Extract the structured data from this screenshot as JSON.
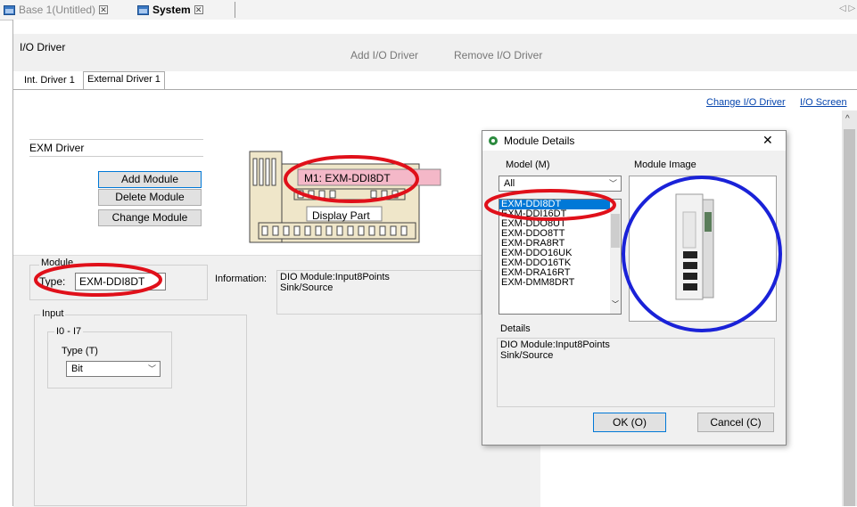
{
  "tabs": [
    {
      "label": "Base 1(Untitled)",
      "active": false
    },
    {
      "label": "System",
      "active": true
    }
  ],
  "header": {
    "title": "I/O Driver",
    "add_label": "Add I/O Driver",
    "remove_label": "Remove I/O Driver"
  },
  "driver_tabs": [
    "Int. Driver 1",
    "External Driver 1"
  ],
  "links": {
    "change_driver": "Change I/O Driver",
    "io_screen": "I/O Screen"
  },
  "driver_field": "EXM Driver",
  "buttons": {
    "add_module": "Add Module",
    "delete_module": "Delete Module",
    "change_module": "Change Module"
  },
  "module_diagram": {
    "m1_label": "M1: EXM-DDI8DT",
    "display_part": "Display Part"
  },
  "module": {
    "group_label": "Module",
    "type_label": "Type:",
    "type_value": "EXM-DDI8DT",
    "info_label": "Information:",
    "info_value": "DIO Module:Input8Points\nSink/Source",
    "input_label": "Input",
    "range_label": "I0 - I7",
    "type_t_label": "Type (T)",
    "type_t_value": "Bit"
  },
  "dialog": {
    "title": "Module Details",
    "model_label": "Model (M)",
    "model_filter": "All",
    "image_label": "Module Image",
    "models": [
      "EXM-DDI8DT",
      "EXM-DDI16DT",
      "EXM-DDO8UT",
      "EXM-DDO8TT",
      "EXM-DRA8RT",
      "EXM-DDO16UK",
      "EXM-DDO16TK",
      "EXM-DRA16RT",
      "EXM-DMM8DRT"
    ],
    "selected_model": "EXM-DDI8DT",
    "details_label": "Details",
    "details_value": "DIO Module:Input8Points\nSink/Source",
    "ok_label": "OK (O)",
    "cancel_label": "Cancel (C)",
    "close_label": "✕"
  },
  "colors": {
    "highlight_red": "#e0101a",
    "highlight_blue": "#1a22d8",
    "selection": "#0078d7",
    "pink_label": "#f4b8c8"
  }
}
